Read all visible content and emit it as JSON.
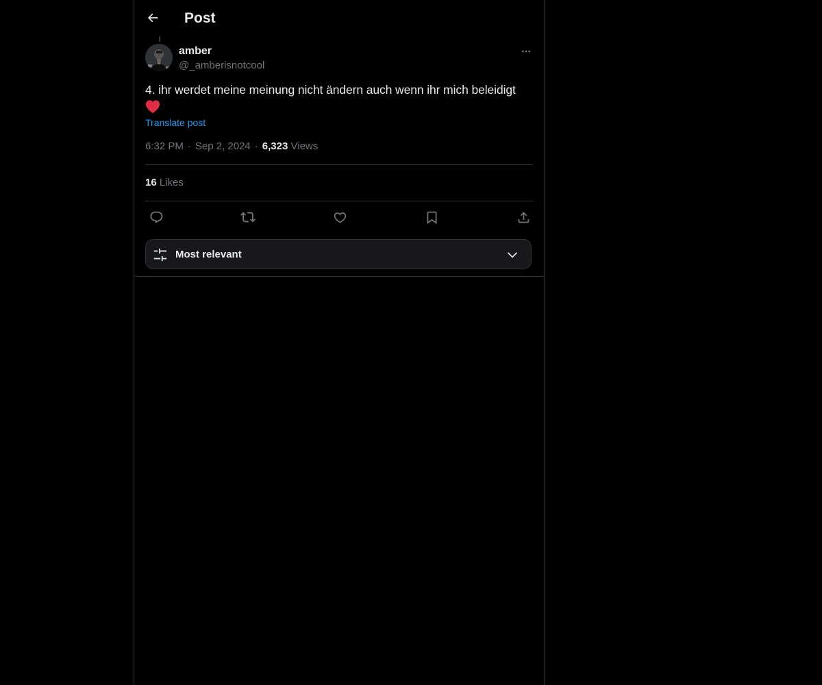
{
  "header": {
    "title": "Post",
    "back_icon": "arrow-left-icon"
  },
  "post": {
    "author": {
      "name": "amber",
      "handle": "@_amberisnotcool",
      "avatar_icon": "avatar-photo"
    },
    "text": "4. ihr werdet meine meinung nicht ändern auch wenn ihr mich beleidigt",
    "emoji": "❤️",
    "translate_label": "Translate post",
    "time": "6:32 PM",
    "separator": "·",
    "date": "Sep 2, 2024",
    "views_count": "6,323",
    "views_label": "Views",
    "likes_count": "16",
    "likes_label": "Likes"
  },
  "actions": [
    {
      "name": "reply",
      "icon": "reply-icon"
    },
    {
      "name": "repost",
      "icon": "repost-icon"
    },
    {
      "name": "like",
      "icon": "heart-icon"
    },
    {
      "name": "bookmark",
      "icon": "bookmark-icon"
    },
    {
      "name": "share",
      "icon": "share-icon"
    }
  ],
  "sort": {
    "label": "Most relevant",
    "icon": "sliders-icon",
    "chevron_icon": "chevron-down-icon"
  },
  "colors": {
    "background": "#000000",
    "text_primary": "#e7e9ea",
    "text_secondary": "#71767b",
    "accent": "#1d9bf0",
    "border": "#2f3336",
    "heart": "#f91880"
  }
}
